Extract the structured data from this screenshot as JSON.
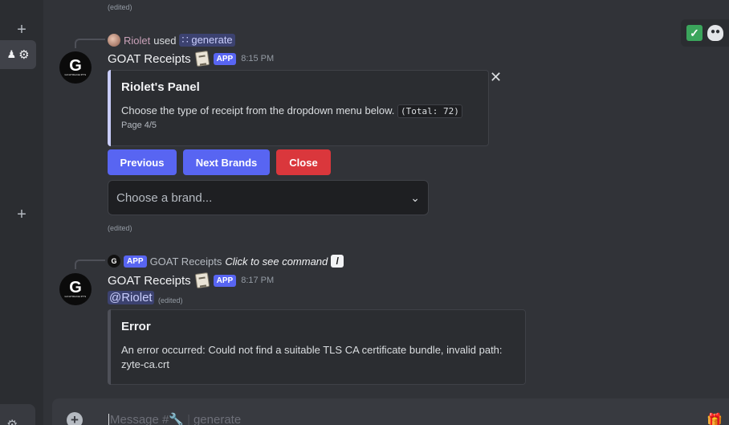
{
  "colors": {
    "blurple": "#5865f2",
    "danger": "#da373c",
    "embed_bar_panel": "#c9cdfb",
    "embed_bar_error": "#4e5058"
  },
  "message_top": {
    "edited": "(edited)"
  },
  "message1": {
    "reply": {
      "user": "Riolet",
      "used": "used",
      "command": "generate"
    },
    "author": "GOAT Receipts",
    "app_tag": "APP",
    "time": "8:15 PM",
    "embed": {
      "title": "Riolet's Panel",
      "description": "Choose the type of receipt from the dropdown menu below.",
      "code": "(Total: 72)",
      "footer": "Page 4/5"
    },
    "buttons": {
      "previous": "Previous",
      "next": "Next Brands",
      "close": "Close"
    },
    "select": {
      "placeholder": "Choose a brand..."
    },
    "edited": "(edited)"
  },
  "message2": {
    "reply": {
      "app_tag": "APP",
      "name": "GOAT Receipts",
      "click": "Click to see command"
    },
    "author": "GOAT Receipts",
    "app_tag": "APP",
    "time": "8:17 PM",
    "mention": "@Riolet",
    "edited": "(edited)",
    "embed": {
      "title": "Error",
      "description": "An error occurred: Could not find a suitable TLS CA certificate bundle, invalid path: zyte-ca.crt"
    }
  },
  "composer": {
    "placeholder": "Message #",
    "command": "generate"
  },
  "icons": [
    "add-server-icon",
    "settings-icon",
    "checkmark-icon",
    "skull-icon",
    "plus-icon",
    "gift-icon",
    "close-icon",
    "chevron-down-icon"
  ]
}
